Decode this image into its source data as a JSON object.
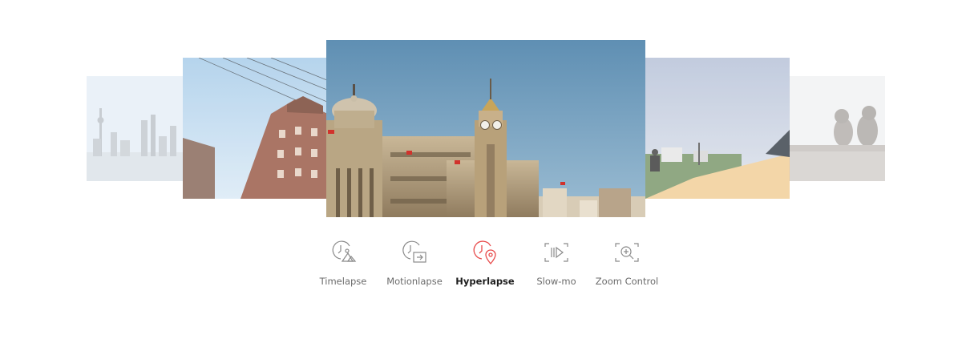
{
  "carousel": {
    "slides": [
      {
        "scene": "city-skyline",
        "position": "far-left"
      },
      {
        "scene": "brick-buildings-power-lines",
        "position": "left"
      },
      {
        "scene": "bund-clock-tower-building",
        "position": "center"
      },
      {
        "scene": "person-on-hill",
        "position": "right"
      },
      {
        "scene": "monkeys",
        "position": "far-right"
      }
    ]
  },
  "modes": [
    {
      "label": "Timelapse",
      "icon": "timelapse-icon",
      "active": false
    },
    {
      "label": "Motionlapse",
      "icon": "motionlapse-icon",
      "active": false
    },
    {
      "label": "Hyperlapse",
      "icon": "hyperlapse-icon",
      "active": true
    },
    {
      "label": "Slow-mo",
      "icon": "slowmo-icon",
      "active": false
    },
    {
      "label": "Zoom Control",
      "icon": "zoom-control-icon",
      "active": false
    }
  ],
  "colors": {
    "active": "#e84a4a",
    "inactive_icon": "#8a8a8a",
    "label": "#6b6b6b",
    "label_active": "#1d1d1d"
  }
}
